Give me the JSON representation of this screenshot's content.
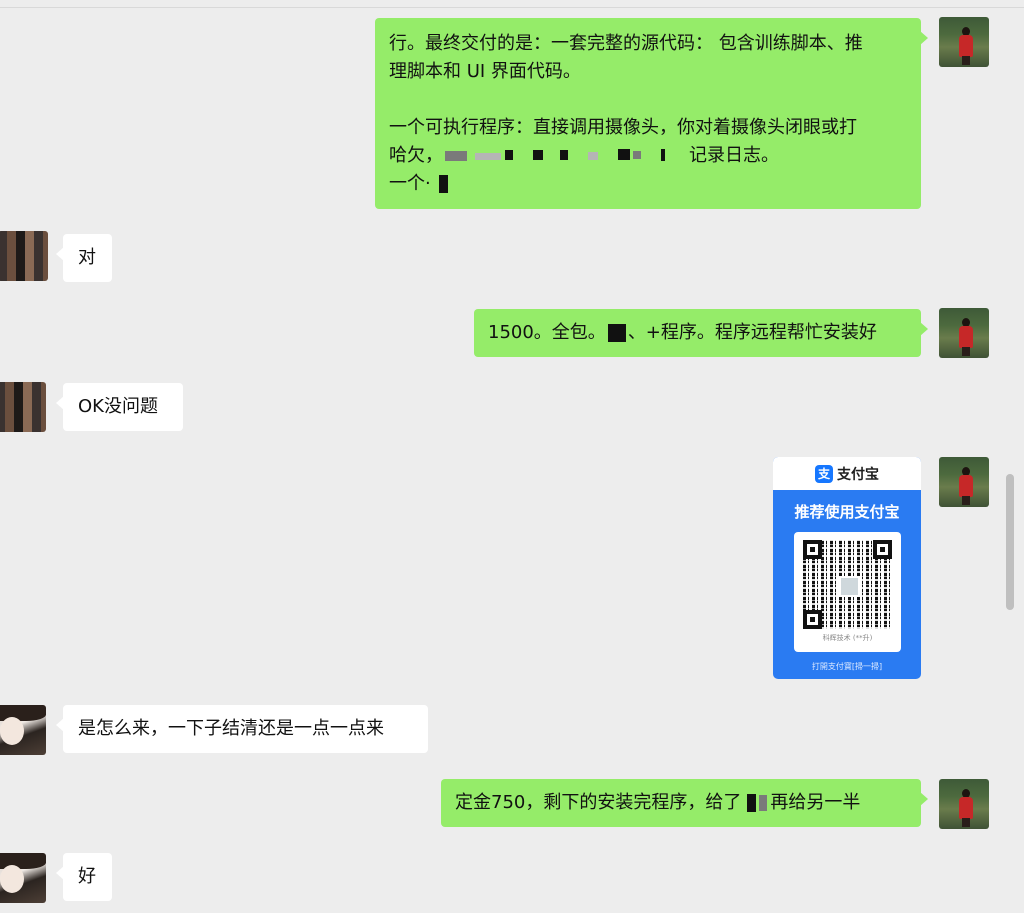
{
  "messages": [
    {
      "sender": "me",
      "lines": [
        "行。最终交付的是：一套完整的源代码： 包含训练脚本、推",
        "理脚本和 UI 界面代码。",
        "",
        "一个可执行程序：直接调用摄像头，你对着摄像头闭眼或打",
        "哈欠，",
        "记录日志。",
        "一个·"
      ]
    },
    {
      "sender": "other",
      "text": "对"
    },
    {
      "sender": "me",
      "text_a": "1500。全包。",
      "text_b": "、+程序。程序远程帮忙安装好"
    },
    {
      "sender": "other",
      "text": "OK没问题"
    },
    {
      "sender": "me",
      "type": "payment_qr",
      "logo_glyph": "支",
      "brand": "支付宝",
      "promo": "推荐使用支付宝",
      "merchant": "科辉技术 (**升)",
      "footer": "打開支付寶[掃一掃]"
    },
    {
      "sender": "other",
      "text": "是怎么来，一下子结清还是一点一点来"
    },
    {
      "sender": "me",
      "text_a": "定金750，剩下的安装完程序，给了",
      "text_b": "再给另一半"
    },
    {
      "sender": "other",
      "text": "好"
    }
  ],
  "colors": {
    "background": "#ededed",
    "my_bubble": "#95ec69",
    "other_bubble": "#ffffff",
    "alipay_blue": "#2a7bf2"
  },
  "icons": {
    "my_avatar": "user-avatar-icon",
    "contact_avatar": "contact-avatar-icon"
  }
}
